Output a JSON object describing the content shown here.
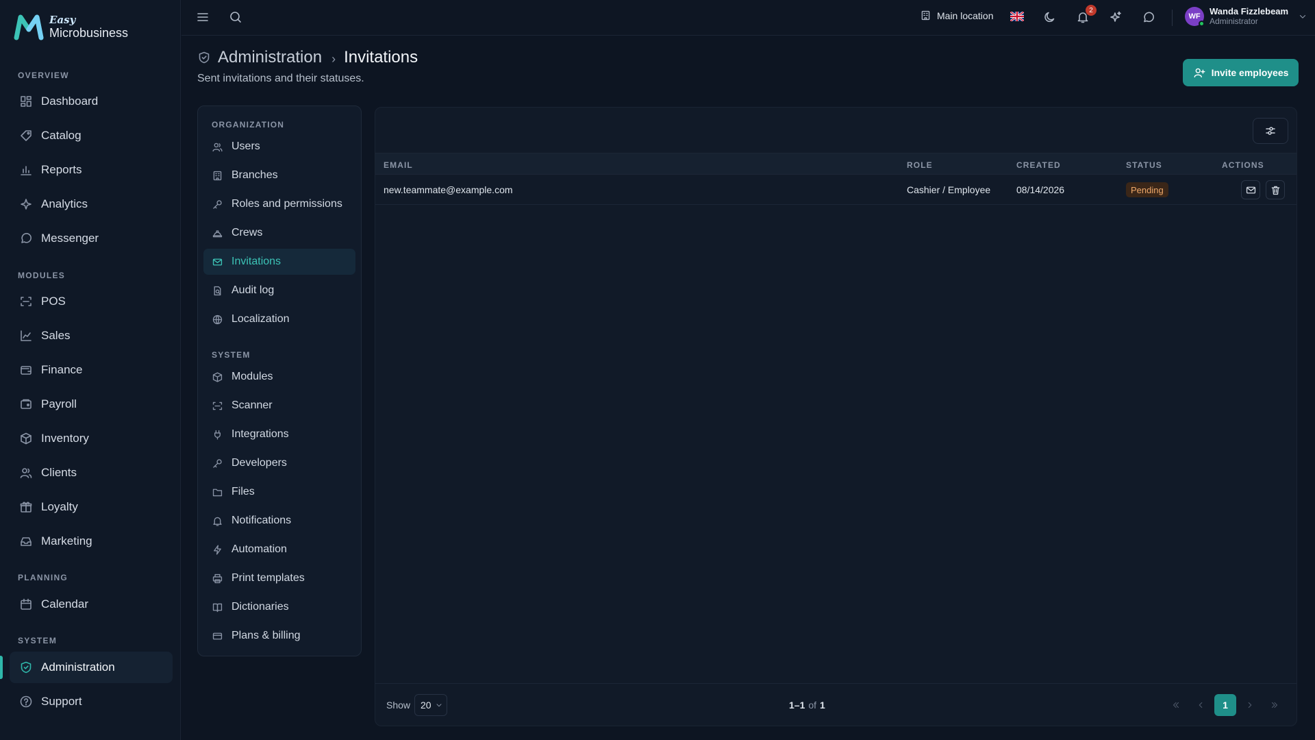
{
  "app": {
    "logo_small": "Easy",
    "logo_name": "Microbusiness"
  },
  "sidebar": {
    "sections": [
      {
        "label": "OVERVIEW"
      },
      {
        "label": "MODULES"
      },
      {
        "label": "PLANNING"
      },
      {
        "label": "SYSTEM"
      }
    ],
    "items": [
      {
        "label": "Dashboard",
        "icon": "dashboard-icon"
      },
      {
        "label": "Catalog",
        "icon": "catalog-icon"
      },
      {
        "label": "Reports",
        "icon": "reports-icon"
      },
      {
        "label": "Analytics",
        "icon": "analytics-icon"
      },
      {
        "label": "Messenger",
        "icon": "messenger-icon"
      },
      {
        "label": "POS",
        "icon": "pos-icon"
      },
      {
        "label": "Sales",
        "icon": "sales-icon"
      },
      {
        "label": "Finance",
        "icon": "finance-icon"
      },
      {
        "label": "Payroll",
        "icon": "payroll-icon"
      },
      {
        "label": "Inventory",
        "icon": "inventory-icon"
      },
      {
        "label": "Clients",
        "icon": "clients-icon"
      },
      {
        "label": "Loyalty",
        "icon": "loyalty-icon"
      },
      {
        "label": "Marketing",
        "icon": "marketing-icon"
      },
      {
        "label": "Calendar",
        "icon": "calendar-icon"
      },
      {
        "label": "Administration",
        "icon": "shield-icon",
        "active": true
      },
      {
        "label": "Support",
        "icon": "help-icon"
      }
    ]
  },
  "topbar": {
    "location": "Main location",
    "notification_count": "2",
    "user": {
      "initials": "WF",
      "name": "Wanda Fizzlebeam",
      "role": "Administrator"
    }
  },
  "header": {
    "breadcrumb_parent": "Administration",
    "breadcrumb_separator": "›",
    "breadcrumb_current": "Invitations",
    "subtitle": "Sent invitations and their statuses.",
    "invite_button": "Invite employees"
  },
  "subnav": {
    "sections": [
      {
        "label": "ORGANIZATION"
      },
      {
        "label": "SYSTEM"
      }
    ],
    "items": [
      {
        "label": "Users"
      },
      {
        "label": "Branches"
      },
      {
        "label": "Roles and permissions"
      },
      {
        "label": "Crews"
      },
      {
        "label": "Invitations",
        "active": true
      },
      {
        "label": "Audit log"
      },
      {
        "label": "Localization"
      },
      {
        "label": "Modules"
      },
      {
        "label": "Scanner"
      },
      {
        "label": "Integrations"
      },
      {
        "label": "Developers"
      },
      {
        "label": "Files"
      },
      {
        "label": "Notifications"
      },
      {
        "label": "Automation"
      },
      {
        "label": "Print templates"
      },
      {
        "label": "Dictionaries"
      },
      {
        "label": "Plans & billing"
      }
    ]
  },
  "table": {
    "columns": [
      "EMAIL",
      "ROLE",
      "CREATED",
      "STATUS",
      "ACTIONS"
    ],
    "rows": [
      {
        "email": "new.teammate@example.com",
        "role": "Cashier / Employee",
        "created": "08/14/2026",
        "status": "Pending"
      }
    ]
  },
  "pagination": {
    "show_label": "Show",
    "page_size": "20",
    "range": "1–1",
    "of_label": "of",
    "total": "1",
    "current_page": "1"
  },
  "colors": {
    "accent": "#1f8f89",
    "background": "#0d1522",
    "pending": "#f0a96a"
  }
}
